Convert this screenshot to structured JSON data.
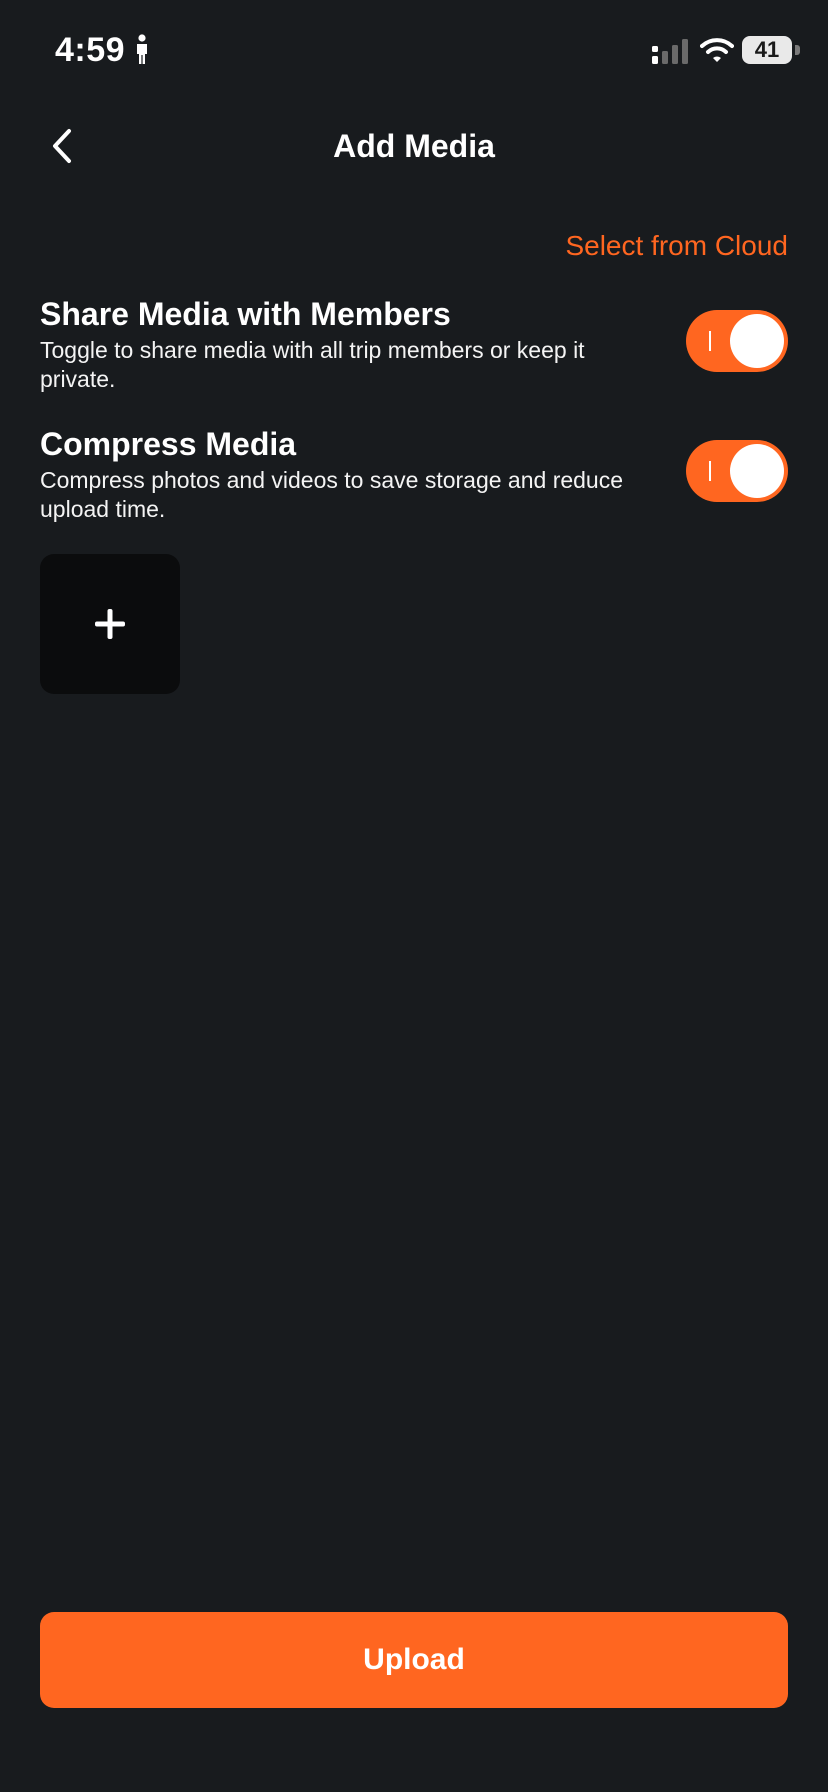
{
  "status_bar": {
    "time": "4:59",
    "battery": "41",
    "icons": [
      "person-icon",
      "signal-icon",
      "wifi-icon",
      "battery-icon"
    ]
  },
  "header": {
    "title": "Add Media",
    "back_icon": "chevron-left-icon"
  },
  "cloud_link": "Select from Cloud",
  "settings": [
    {
      "title": "Share Media with Members",
      "description": "Toggle to share media with all trip members or keep it private.",
      "enabled": true
    },
    {
      "title": "Compress Media",
      "description": "Compress photos and videos to save storage and reduce upload time.",
      "enabled": true
    }
  ],
  "add_media_icon": "plus-icon",
  "upload_label": "Upload",
  "colors": {
    "background": "#181b1e",
    "accent": "#ff6620",
    "tile": "#0b0c0d",
    "text": "#ffffff"
  }
}
